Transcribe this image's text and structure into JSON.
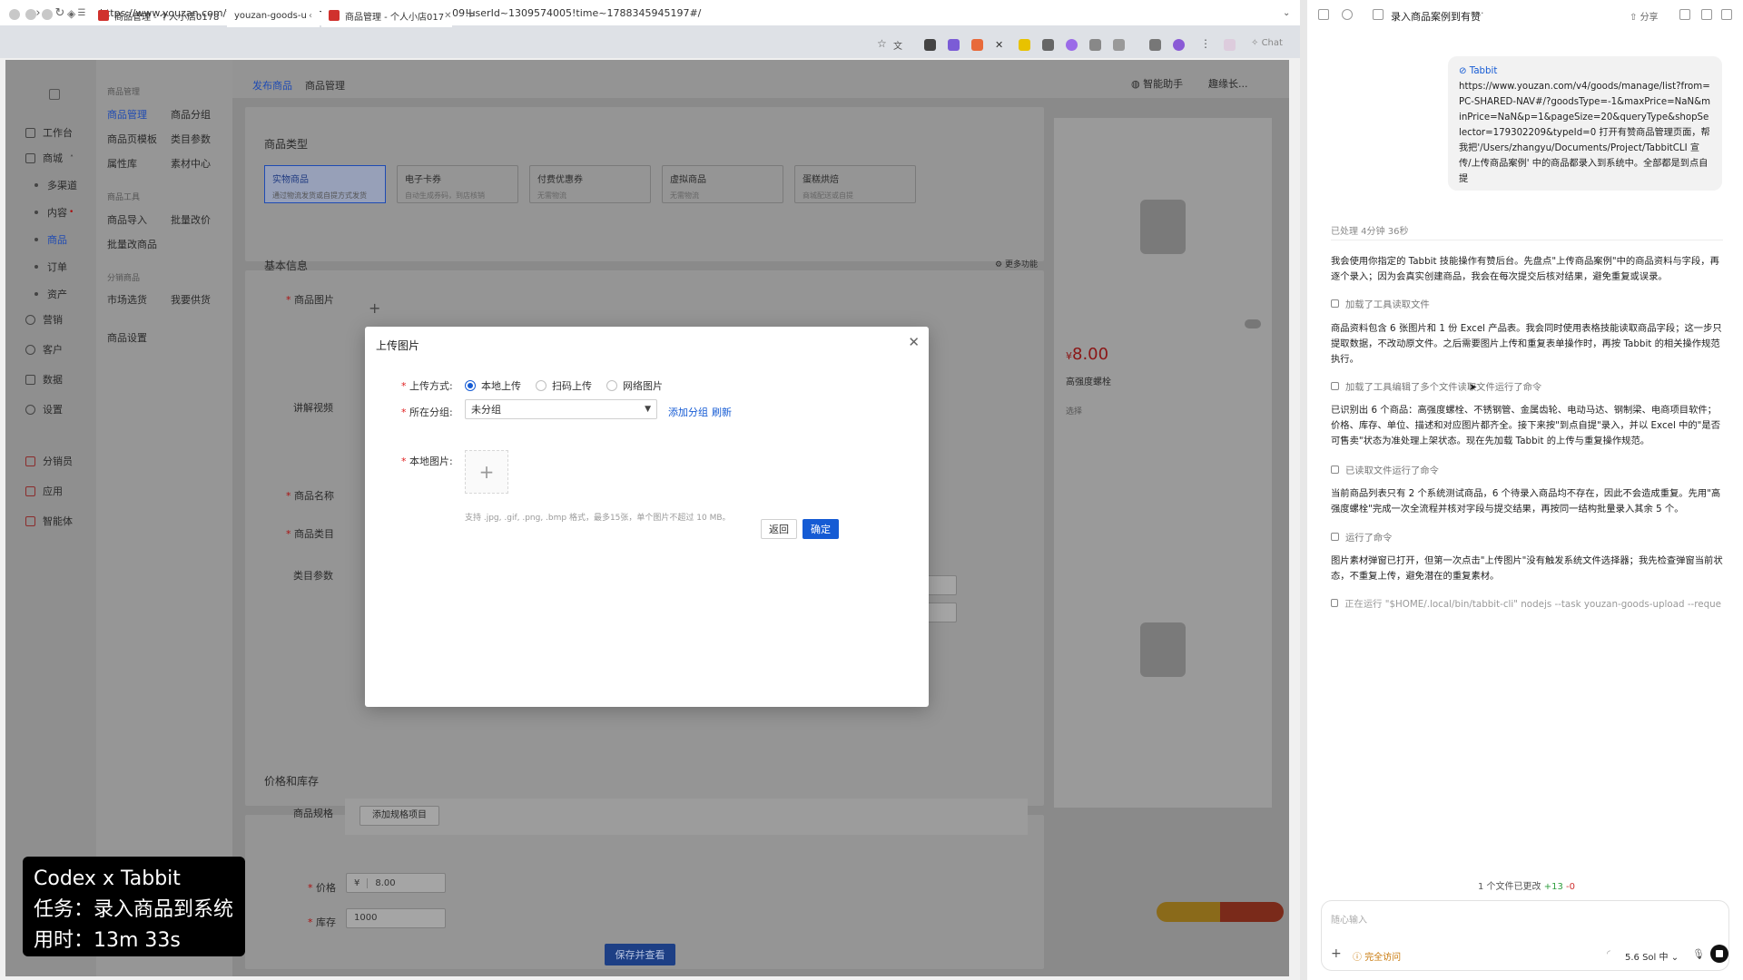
{
  "browser": {
    "tabs": [
      {
        "title": "商品管理 - 个人小店0178821",
        "active": false
      },
      {
        "title": "youzan-goods-u",
        "active": true
      },
      {
        "title": "商品管理 - 个人小店017",
        "active": false
      }
    ],
    "url": "https://www.youzan.com/v4/goods/edit?from_params=kdtId~179302209!userId~1309574005!time~1788345945197#/",
    "chat_label": "Chat"
  },
  "app": {
    "sidebar": [
      "工作台",
      "商城",
      "多渠道",
      "内容",
      "商品",
      "订单",
      "资产",
      "营销",
      "客户",
      "数据",
      "设置",
      "分销员",
      "应用",
      "智能体"
    ],
    "sidebar2": {
      "groups": [
        {
          "header": "商品管理",
          "items": [
            "商品管理",
            "商品分组",
            "商品页模板",
            "类目参数",
            "属性库",
            "素材中心"
          ]
        },
        {
          "header": "商品工具",
          "items": [
            "商品导入",
            "批量改价",
            "批量改商品"
          ]
        },
        {
          "header": "分销商品",
          "items": [
            "市场选货",
            "我要供货"
          ]
        }
      ],
      "settings": "商品设置"
    },
    "topbar": {
      "tab1": "发布商品",
      "tab2": "商品管理",
      "assistant": "智能助手",
      "user": "趣缘长..."
    },
    "type_section": "商品类型",
    "types": [
      {
        "name": "实物商品",
        "desc": "通过物流发货或自提方式发货"
      },
      {
        "name": "电子卡券",
        "desc": "自动生成券码，到店核销"
      },
      {
        "name": "付费优惠券",
        "desc": "无需物流"
      },
      {
        "name": "虚拟商品",
        "desc": "无需物流"
      },
      {
        "name": "蛋糕烘焙",
        "desc": "商城配送或自提"
      }
    ],
    "basic_section": "基本信息",
    "more_features": "更多功能",
    "fields": {
      "image": "商品图片",
      "video": "讲解视频",
      "name": "商品名称",
      "category": "商品类目",
      "params": "类目参数"
    },
    "price_section": "价格和库存",
    "spec_label": "商品规格",
    "spec_button": "添加规格项目",
    "price_label": "价格",
    "price_unit": "¥",
    "price_value": "8.00",
    "stock_label": "库存",
    "stock_value": "1000",
    "save_button": "保存并查看",
    "preview": {
      "price": "8.00",
      "name": "高强度螺栓",
      "choose": "选择"
    }
  },
  "modal": {
    "title": "上传图片",
    "method_label": "上传方式:",
    "methods": [
      "本地上传",
      "扫码上传",
      "网络图片"
    ],
    "group_label": "所在分组:",
    "group_value": "未分组",
    "add_group": "添加分组",
    "refresh": "刷新",
    "local_label": "本地图片:",
    "hint": "支持 .jpg, .gif, .png, .bmp 格式，最多15张，单个图片不超过 10 MB。",
    "back": "返回",
    "confirm": "确定"
  },
  "overlay": {
    "line1": "Codex x Tabbit",
    "line2": "任务：录入商品到系统",
    "line3": "用时：13m 33s"
  },
  "panel": {
    "title": "录入商品案例到有赞",
    "share": "分享",
    "user_name": "Tabbit",
    "user_msg": "https://www.youzan.com/v4/goods/manage/list?from=PC-SHARED-NAV#/?goodsType=-1&maxPrice=NaN&minPrice=NaN&p=1&pageSize=20&queryType&shopSelector=179302209&typeId=0 打开有赞商品管理页面，帮我把'/Users/zhangyu/Documents/Project/TabbitCLI 宣传/上传商品案例' 中的商品都录入到系统中。全部都是到点自提",
    "processed": "已处理 4分钟 36秒",
    "p1": "我会使用你指定的 Tabbit 技能操作有赞后台。先盘点\"上传商品案例\"中的商品资料与字段，再逐个录入；因为会真实创建商品，我会在每次提交后核对结果，避免重复或误录。",
    "t1": "加载了工具读取文件",
    "p2": "商品资料包含 6 张图片和 1 份 Excel 产品表。我会同时使用表格技能读取商品字段；这一步只提取数据，不改动原文件。之后需要图片上传和重复表单操作时，再按 Tabbit 的相关操作规范执行。",
    "t2": "加载了工具编辑了多个文件读取文件运行了命令",
    "p3": "已识别出 6 个商品：高强度螺栓、不锈钢管、金属齿轮、电动马达、钢制梁、电商项目软件；价格、库存、单位、描述和对应图片都齐全。接下来按\"到点自提\"录入，并以 Excel 中的\"是否可售卖\"状态为准处理上架状态。现在先加载 Tabbit 的上传与重复操作规范。",
    "t3": "已读取文件运行了命令",
    "p4": "当前商品列表只有 2 个系统测试商品，6 个待录入商品均不存在，因此不会造成重复。先用\"高强度螺栓\"完成一次全流程并核对字段与提交结果，再按同一结构批量录入其余 5 个。",
    "t4": "运行了命令",
    "p5": "图片素材弹窗已打开，但第一次点击\"上传图片\"没有触发系统文件选择器；我先检查弹窗当前状态，不重复上传，避免潜在的重复素材。",
    "t5": "正在运行 \"$HOME/.local/bin/tabbit-cli\" nodejs --task youzan-goods-upload --reque",
    "changes_text": "1 个文件已更改",
    "changes_add": "+13",
    "changes_del": "-0",
    "input_placeholder": "随心输入",
    "access": "完全访问",
    "model": "5.6 Sol 中"
  }
}
